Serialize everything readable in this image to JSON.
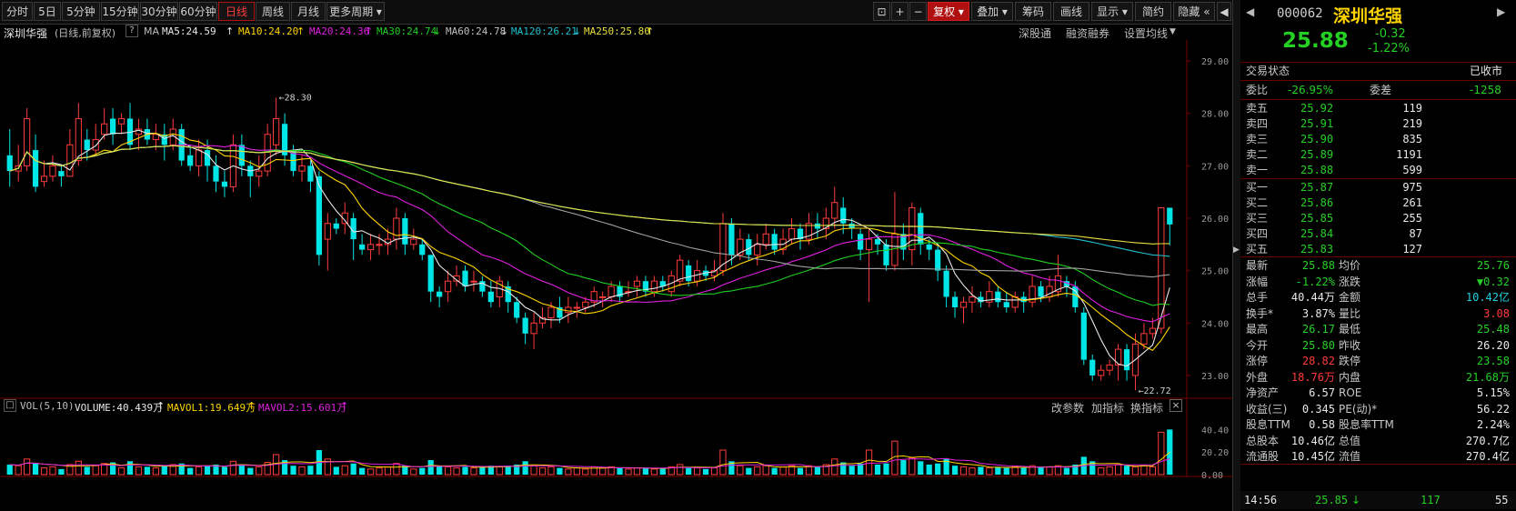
{
  "toolbar": {
    "periods": [
      "分时",
      "5日",
      "5分钟",
      "15分钟",
      "30分钟",
      "60分钟",
      "日线",
      "周线",
      "月线",
      "更多周期"
    ],
    "active_period": "日线",
    "right_buttons": [
      "复权",
      "叠加",
      "筹码",
      "画线",
      "显示",
      "简约",
      "隐藏"
    ]
  },
  "ma_line": {
    "name": "深圳华强",
    "mode": "(日线,前复权)",
    "ma_label": "MA",
    "ma5": "MA5:24.59",
    "ma10": "MA10:24.20",
    "ma20": "MA20:24.36",
    "ma30": "MA30:24.74",
    "ma60": "MA60:24.78",
    "ma120": "MA120:26.21",
    "ma250": "MA250:25.80",
    "links": [
      "深股通",
      "融资融券",
      "设置均线"
    ]
  },
  "price_axis": [
    "29.00",
    "28.00",
    "27.00",
    "26.00",
    "25.00",
    "24.00",
    "23.00"
  ],
  "annotations": {
    "high": "28.30",
    "low": "22.72"
  },
  "vol_header": {
    "label": "VOL(5,10)",
    "volume": "VOLUME:40.439万",
    "mavol1": "MAVOL1:19.649万",
    "mavol2": "MAVOL2:15.601万",
    "links": [
      "改参数",
      "加指标",
      "换指标"
    ]
  },
  "vol_axis": [
    "40.40",
    "20.20",
    "0.00"
  ],
  "colors": {
    "up": "#ff3b3b",
    "down": "#00e5e5",
    "ma5": "#e8e8e8",
    "ma10": "#ffd400",
    "ma20": "#e020e0",
    "ma30": "#20d020",
    "ma60": "#a0a0a0",
    "ma120": "#20c0d0",
    "ma250": "#e8e040"
  },
  "quote": {
    "code": "000062",
    "name": "深圳华强",
    "price": "25.88",
    "change": "-0.32",
    "change_pct": "-1.22%",
    "trade_state_label": "交易状态",
    "trade_state": "已收市",
    "weibi_label": "委比",
    "weibi": "-26.95%",
    "weicha_label": "委差",
    "weicha": "-1258"
  },
  "asks": [
    {
      "label": "卖五",
      "price": "25.92",
      "vol": "119"
    },
    {
      "label": "卖四",
      "price": "25.91",
      "vol": "219"
    },
    {
      "label": "卖三",
      "price": "25.90",
      "vol": "835"
    },
    {
      "label": "卖二",
      "price": "25.89",
      "vol": "1191"
    },
    {
      "label": "卖一",
      "price": "25.88",
      "vol": "599"
    }
  ],
  "bids": [
    {
      "label": "买一",
      "price": "25.87",
      "vol": "975"
    },
    {
      "label": "买二",
      "price": "25.86",
      "vol": "261"
    },
    {
      "label": "买三",
      "price": "25.85",
      "vol": "255"
    },
    {
      "label": "买四",
      "price": "25.84",
      "vol": "87"
    },
    {
      "label": "买五",
      "price": "25.83",
      "vol": "127"
    }
  ],
  "stats": [
    {
      "l1": "最新",
      "v1": "25.88",
      "c1": "grn",
      "l2": "均价",
      "v2": "25.76",
      "c2": "grn"
    },
    {
      "l1": "涨幅",
      "v1": "-1.22%",
      "c1": "grn",
      "l2": "涨跌",
      "v2": "▼0.32",
      "c2": "grn"
    },
    {
      "l1": "总手",
      "v1": "40.44万",
      "c1": "wht",
      "l2": "金额",
      "v2": "10.42亿",
      "c2": "cyan"
    },
    {
      "l1": "换手*",
      "v1": "3.87%",
      "c1": "wht",
      "l2": "量比",
      "v2": "3.08",
      "c2": "red"
    },
    {
      "l1": "最高",
      "v1": "26.17",
      "c1": "grn",
      "l2": "最低",
      "v2": "25.48",
      "c2": "grn"
    },
    {
      "l1": "今开",
      "v1": "25.80",
      "c1": "grn",
      "l2": "昨收",
      "v2": "26.20",
      "c2": "wht"
    },
    {
      "l1": "涨停",
      "v1": "28.82",
      "c1": "red",
      "l2": "跌停",
      "v2": "23.58",
      "c2": "grn"
    },
    {
      "l1": "外盘",
      "v1": "18.76万",
      "c1": "red",
      "l2": "内盘",
      "v2": "21.68万",
      "c2": "grn"
    },
    {
      "l1": "净资产",
      "v1": "6.57",
      "c1": "wht",
      "l2": "ROE",
      "v2": "5.15%",
      "c2": "wht"
    },
    {
      "l1": "收益(三)",
      "v1": "0.345",
      "c1": "wht",
      "l2": "PE(动)*",
      "v2": "56.22",
      "c2": "wht"
    },
    {
      "l1": "股息TTM",
      "v1": "0.58",
      "c1": "wht",
      "l2": "股息率TTM",
      "v2": "2.24%",
      "c2": "wht"
    },
    {
      "l1": "总股本",
      "v1": "10.46亿",
      "c1": "wht",
      "l2": "总值",
      "v2": "270.7亿",
      "c2": "wht"
    },
    {
      "l1": "流通股",
      "v1": "10.45亿",
      "c1": "wht",
      "l2": "流值",
      "v2": "270.4亿",
      "c2": "wht"
    }
  ],
  "last_tick": {
    "time": "14:56",
    "price": "25.85",
    "arrow": "↓",
    "vol": "117",
    "count": "55"
  },
  "chart_data": {
    "type": "candlestick",
    "price_range": [
      22.6,
      29.4
    ],
    "candles": [
      [
        27.2,
        26.9,
        27.7,
        26.6
      ],
      [
        26.9,
        27.0,
        27.4,
        26.7
      ],
      [
        27.0,
        27.9,
        28.1,
        26.9
      ],
      [
        27.3,
        26.6,
        27.6,
        26.5
      ],
      [
        26.7,
        26.8,
        27.1,
        26.6
      ],
      [
        26.8,
        27.0,
        27.2,
        26.7
      ],
      [
        26.9,
        26.8,
        27.0,
        26.6
      ],
      [
        26.8,
        27.4,
        27.7,
        26.8
      ],
      [
        27.1,
        27.9,
        28.2,
        27.0
      ],
      [
        27.5,
        27.3,
        27.7,
        27.1
      ],
      [
        27.3,
        27.5,
        27.8,
        27.2
      ],
      [
        27.6,
        27.8,
        28.1,
        27.5
      ],
      [
        27.9,
        27.6,
        28.1,
        27.4
      ],
      [
        27.8,
        27.9,
        28.0,
        27.6
      ],
      [
        27.9,
        27.4,
        28.2,
        27.3
      ],
      [
        27.6,
        27.7,
        27.9,
        27.3
      ],
      [
        27.7,
        27.5,
        27.9,
        27.4
      ],
      [
        27.5,
        27.6,
        27.8,
        27.3
      ],
      [
        27.6,
        27.4,
        27.8,
        27.1
      ],
      [
        27.4,
        27.7,
        27.9,
        27.3
      ],
      [
        27.7,
        27.1,
        27.8,
        27.0
      ],
      [
        27.2,
        27.0,
        27.4,
        26.9
      ],
      [
        27.0,
        27.3,
        27.5,
        26.8
      ],
      [
        27.3,
        27.0,
        27.5,
        26.7
      ],
      [
        27.0,
        26.7,
        27.2,
        26.5
      ],
      [
        26.7,
        26.6,
        26.9,
        26.4
      ],
      [
        26.6,
        27.4,
        27.6,
        26.5
      ],
      [
        27.4,
        27.0,
        27.6,
        26.8
      ],
      [
        27.0,
        26.8,
        27.1,
        26.4
      ],
      [
        26.8,
        26.9,
        27.2,
        26.6
      ],
      [
        26.9,
        27.6,
        27.8,
        26.8
      ],
      [
        27.4,
        27.9,
        28.3,
        27.2
      ],
      [
        27.8,
        27.2,
        28.0,
        27.0
      ],
      [
        27.3,
        26.9,
        27.4,
        26.8
      ],
      [
        26.9,
        27.0,
        27.2,
        26.7
      ],
      [
        27.0,
        26.7,
        27.1,
        26.5
      ],
      [
        26.8,
        25.3,
        26.9,
        25.1
      ],
      [
        25.6,
        25.9,
        26.1,
        25.0
      ],
      [
        25.9,
        25.8,
        26.0,
        25.7
      ],
      [
        25.9,
        26.1,
        26.3,
        25.7
      ],
      [
        26.0,
        25.6,
        26.1,
        25.2
      ],
      [
        25.5,
        25.4,
        25.7,
        25.3
      ],
      [
        25.4,
        25.5,
        25.7,
        25.2
      ],
      [
        25.5,
        25.5,
        25.7,
        25.3
      ],
      [
        25.5,
        25.6,
        25.8,
        25.3
      ],
      [
        25.6,
        26.0,
        26.2,
        25.4
      ],
      [
        26.0,
        25.5,
        26.1,
        25.3
      ],
      [
        25.5,
        25.6,
        25.8,
        25.4
      ],
      [
        25.5,
        25.3,
        25.6,
        25.2
      ],
      [
        25.3,
        24.6,
        25.3,
        24.4
      ],
      [
        24.6,
        24.5,
        24.7,
        24.3
      ],
      [
        24.6,
        24.8,
        25.0,
        24.4
      ],
      [
        24.8,
        24.9,
        25.1,
        24.7
      ],
      [
        25.0,
        24.7,
        25.1,
        24.6
      ],
      [
        24.8,
        24.8,
        25.0,
        24.6
      ],
      [
        24.8,
        24.6,
        24.9,
        24.5
      ],
      [
        24.6,
        24.4,
        24.8,
        24.3
      ],
      [
        24.5,
        24.8,
        24.9,
        24.3
      ],
      [
        24.7,
        24.4,
        24.8,
        24.2
      ],
      [
        24.4,
        24.1,
        24.5,
        24.0
      ],
      [
        24.1,
        23.8,
        24.2,
        23.6
      ],
      [
        23.8,
        24.0,
        24.2,
        23.5
      ],
      [
        24.0,
        24.1,
        24.3,
        23.9
      ],
      [
        24.1,
        24.3,
        24.4,
        23.9
      ],
      [
        24.3,
        24.1,
        24.5,
        24.0
      ],
      [
        24.2,
        24.3,
        24.5,
        24.0
      ],
      [
        24.3,
        24.3,
        24.4,
        24.1
      ],
      [
        24.3,
        24.4,
        24.5,
        24.2
      ],
      [
        24.4,
        24.6,
        24.7,
        24.3
      ],
      [
        24.5,
        24.5,
        24.6,
        24.3
      ],
      [
        24.5,
        24.7,
        24.8,
        24.4
      ],
      [
        24.7,
        24.5,
        24.8,
        24.4
      ],
      [
        24.6,
        24.6,
        24.8,
        24.5
      ],
      [
        24.7,
        24.8,
        24.9,
        24.5
      ],
      [
        24.8,
        24.6,
        24.9,
        24.5
      ],
      [
        24.6,
        24.8,
        24.9,
        24.5
      ],
      [
        24.8,
        24.7,
        24.9,
        24.6
      ],
      [
        24.6,
        24.9,
        25.0,
        24.5
      ],
      [
        24.8,
        25.2,
        25.3,
        24.7
      ],
      [
        25.1,
        24.8,
        25.2,
        24.7
      ],
      [
        24.8,
        25.0,
        25.2,
        24.7
      ],
      [
        25.0,
        24.9,
        25.1,
        24.8
      ],
      [
        24.9,
        25.0,
        25.2,
        24.8
      ],
      [
        25.0,
        25.9,
        26.1,
        24.9
      ],
      [
        25.9,
        25.3,
        26.0,
        25.1
      ],
      [
        25.3,
        25.6,
        25.8,
        25.2
      ],
      [
        25.6,
        25.3,
        25.7,
        25.2
      ],
      [
        25.3,
        25.5,
        25.7,
        25.1
      ],
      [
        25.5,
        25.7,
        25.9,
        25.4
      ],
      [
        25.7,
        25.4,
        25.8,
        25.3
      ],
      [
        25.4,
        25.6,
        25.8,
        25.3
      ],
      [
        25.6,
        25.8,
        26.0,
        25.5
      ],
      [
        25.8,
        25.6,
        25.9,
        25.4
      ],
      [
        25.6,
        25.9,
        26.1,
        25.5
      ],
      [
        25.9,
        25.8,
        26.1,
        25.6
      ],
      [
        25.8,
        26.0,
        26.2,
        25.6
      ],
      [
        26.0,
        26.3,
        26.6,
        25.8
      ],
      [
        26.2,
        25.9,
        26.4,
        25.7
      ],
      [
        25.9,
        25.8,
        26.0,
        25.6
      ],
      [
        25.7,
        25.4,
        25.8,
        25.2
      ],
      [
        25.4,
        25.6,
        25.8,
        24.4
      ],
      [
        25.6,
        25.5,
        25.7,
        25.3
      ],
      [
        25.5,
        25.1,
        25.6,
        25.0
      ],
      [
        25.1,
        25.7,
        26.5,
        25.0
      ],
      [
        25.7,
        25.4,
        25.9,
        25.2
      ],
      [
        25.4,
        26.2,
        26.3,
        25.1
      ],
      [
        26.1,
        25.5,
        26.2,
        25.3
      ],
      [
        25.5,
        25.4,
        25.6,
        25.2
      ],
      [
        25.4,
        25.0,
        25.5,
        24.8
      ],
      [
        25.0,
        24.5,
        25.1,
        24.3
      ],
      [
        24.5,
        24.3,
        24.6,
        24.1
      ],
      [
        24.3,
        24.4,
        24.5,
        24.0
      ],
      [
        24.4,
        24.5,
        24.7,
        24.2
      ],
      [
        24.5,
        24.4,
        24.6,
        24.3
      ],
      [
        24.4,
        24.6,
        24.8,
        24.3
      ],
      [
        24.6,
        24.4,
        24.7,
        24.3
      ],
      [
        24.4,
        24.3,
        24.6,
        24.2
      ],
      [
        24.3,
        24.5,
        24.6,
        24.2
      ],
      [
        24.5,
        24.4,
        24.6,
        24.2
      ],
      [
        24.4,
        24.7,
        24.9,
        24.3
      ],
      [
        24.7,
        24.5,
        24.8,
        24.4
      ],
      [
        24.5,
        24.7,
        24.9,
        24.4
      ],
      [
        24.6,
        24.9,
        25.3,
        24.5
      ],
      [
        24.8,
        24.7,
        24.9,
        24.5
      ],
      [
        24.7,
        24.3,
        24.8,
        24.2
      ],
      [
        24.2,
        23.3,
        24.3,
        23.2
      ],
      [
        23.3,
        23.0,
        23.4,
        22.9
      ],
      [
        23.0,
        23.1,
        23.2,
        22.9
      ],
      [
        23.1,
        23.2,
        23.3,
        23.0
      ],
      [
        23.2,
        23.5,
        23.6,
        22.9
      ],
      [
        23.5,
        23.1,
        23.6,
        22.9
      ],
      [
        23.0,
        23.6,
        23.8,
        22.72
      ],
      [
        23.6,
        23.8,
        24.0,
        23.5
      ],
      [
        23.8,
        23.9,
        24.1,
        23.7
      ],
      [
        23.9,
        26.2,
        26.2,
        23.8
      ],
      [
        26.2,
        25.88,
        26.17,
        25.48
      ]
    ],
    "volume_range": [
      0,
      44
    ],
    "volumes": [
      9,
      8,
      14,
      10,
      6,
      7,
      5,
      9,
      12,
      7,
      8,
      10,
      11,
      6,
      12,
      7,
      7,
      6,
      8,
      9,
      10,
      6,
      7,
      8,
      9,
      7,
      12,
      9,
      6,
      7,
      11,
      18,
      13,
      8,
      7,
      8,
      22,
      14,
      7,
      8,
      10,
      6,
      5,
      6,
      7,
      10,
      8,
      5,
      6,
      13,
      8,
      7,
      6,
      7,
      6,
      7,
      8,
      7,
      8,
      9,
      12,
      8,
      6,
      7,
      6,
      5,
      6,
      5,
      7,
      6,
      7,
      6,
      5,
      6,
      6,
      5,
      6,
      7,
      9,
      6,
      6,
      5,
      6,
      22,
      12,
      8,
      6,
      7,
      8,
      6,
      7,
      8,
      6,
      8,
      7,
      9,
      14,
      11,
      8,
      10,
      22,
      9,
      10,
      30,
      13,
      15,
      12,
      9,
      10,
      14,
      8,
      7,
      6,
      7,
      6,
      7,
      6,
      7,
      6,
      8,
      7,
      7,
      8,
      6,
      9,
      16,
      12,
      6,
      7,
      9,
      8,
      7,
      8,
      7,
      38,
      40.44
    ]
  }
}
